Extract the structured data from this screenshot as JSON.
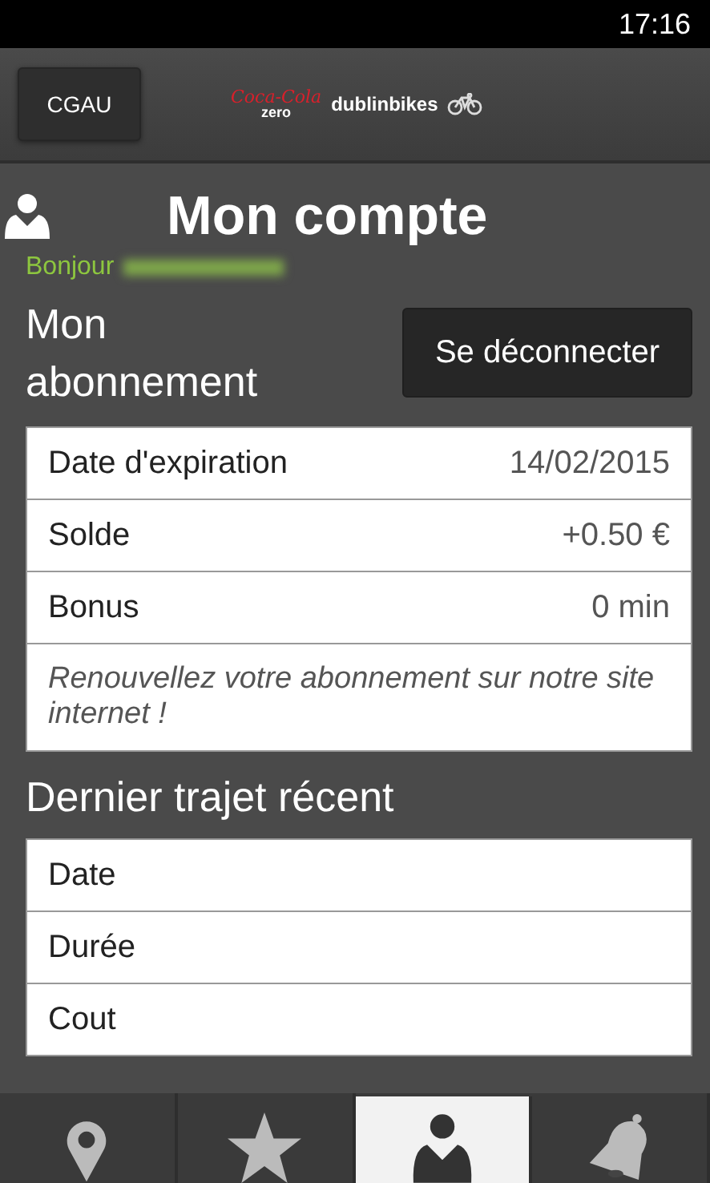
{
  "status_bar": {
    "time": "17:16"
  },
  "header": {
    "button": "CGAU",
    "sponsor": "Coca-Cola",
    "sponsor_sub": "zero",
    "brand": "dublinbikes"
  },
  "title": "Mon compte",
  "greeting": "Bonjour",
  "subscription": {
    "heading": "Mon abonnement",
    "logout": "Se déconnecter",
    "rows": [
      {
        "label": "Date d'expiration",
        "value": "14/02/2015"
      },
      {
        "label": "Solde",
        "value": "+0.50 €"
      },
      {
        "label": "Bonus",
        "value": "0 min"
      }
    ],
    "note": "Renouvellez votre abonnement sur notre site internet !"
  },
  "last_trip": {
    "heading": "Dernier trajet récent",
    "rows": [
      {
        "label": "Date"
      },
      {
        "label": "Durée"
      },
      {
        "label": "Cout"
      }
    ]
  },
  "tabs": [
    {
      "kind": "map",
      "selected": false
    },
    {
      "kind": "favorites",
      "selected": false
    },
    {
      "kind": "account",
      "selected": true
    },
    {
      "kind": "alerts",
      "selected": false
    }
  ]
}
